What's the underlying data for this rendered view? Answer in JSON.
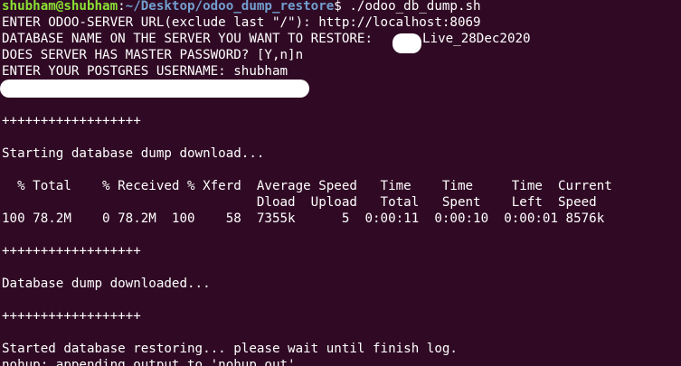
{
  "terminal": {
    "prompt": {
      "user_host": "shubham@shubham",
      "separator": ":",
      "path": "~/Desktop/odoo_dump_restore",
      "symbol": "$ ",
      "command": "./odoo_db_dump.sh"
    },
    "lines": {
      "server_url": "ENTER ODOO-SERVER URL(exclude last \"/\"): http://localhost:8069",
      "db_name_prefix": "DATABASE NAME ON THE SERVER YOU WANT TO RESTORE:",
      "db_name_suffix": "Live_28Dec2020",
      "master_password": "DOES SERVER HAS MASTER PASSWORD? [Y,n]n",
      "pg_username": "ENTER YOUR POSTGRES USERNAME: shubham",
      "divider_1": "++++++++++++++++++",
      "start_download": "Starting database dump download...",
      "curl_header_1": "  % Total    % Received % Xferd  Average Speed   Time    Time     Time  Current",
      "curl_header_2": "                                 Dload  Upload   Total   Spent    Left  Speed",
      "curl_progress": "100 78.2M    0 78.2M  100    58  7355k      5  0:00:11  0:00:10  0:00:01 8576k",
      "divider_2": "++++++++++++++++++",
      "downloaded": "Database dump downloaded...",
      "divider_3": "++++++++++++++++++",
      "restoring": "Started database restoring... please wait until finish log.",
      "nohup": "nohup: appending output to 'nohup.out'"
    },
    "colors": {
      "background": "#300a24",
      "user_host": "#8ae234",
      "path": "#729fcf",
      "text": "#ffffff"
    }
  }
}
